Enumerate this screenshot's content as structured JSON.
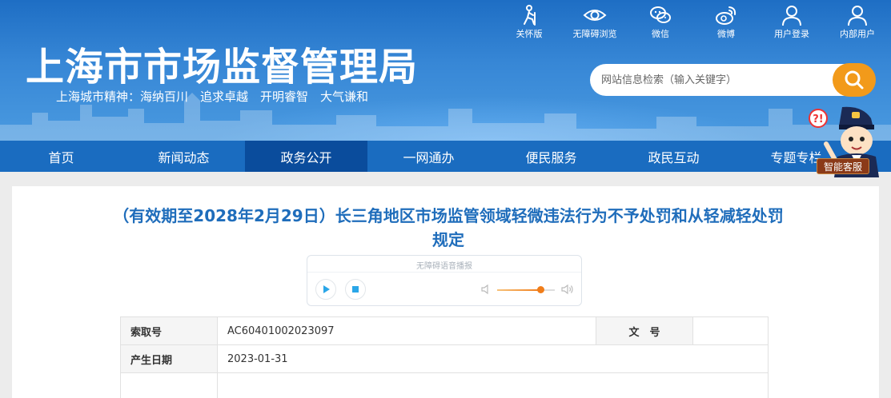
{
  "header": {
    "site_title": "上海市市场监督管理局",
    "slogan": "上海城市精神：海纳百川　追求卓越　开明睿智　大气谦和",
    "top_links": [
      {
        "label": "关怀版",
        "icon": "elderly-care-icon"
      },
      {
        "label": "无障碍浏览",
        "icon": "eye-icon"
      },
      {
        "label": "微信",
        "icon": "wechat-icon"
      },
      {
        "label": "微博",
        "icon": "weibo-icon"
      },
      {
        "label": "用户登录",
        "icon": "user-icon"
      },
      {
        "label": "内部用户",
        "icon": "user-icon"
      }
    ],
    "search": {
      "placeholder": "网站信息检索（输入关键字）",
      "icon": "search-icon"
    },
    "colors": {
      "header_blue": "#2a7bcf",
      "nav_blue": "#1a6cc0",
      "nav_active": "#0a4c9c",
      "search_orange": "#f29a1a",
      "title_blue": "#1f6dbb"
    }
  },
  "nav": {
    "items": [
      "首页",
      "新闻动态",
      "政务公开",
      "一网通办",
      "便民服务",
      "政民互动",
      "专题专栏"
    ],
    "active_index": 2
  },
  "service_bot": {
    "label": "智能客服",
    "icon": "customer-service-robot-icon"
  },
  "document": {
    "title": "（有效期至2028年2月29日）长三角地区市场监管领域轻微违法行为不予处罚和从轻减轻处罚规定",
    "player": {
      "title": "无障碍语音播报",
      "volume_level": 0.75,
      "play_icon": "play-icon",
      "stop_icon": "stop-icon"
    },
    "meta": {
      "row1": {
        "k1": "索取号",
        "v1": "AC60401002023097",
        "k2": "文　号",
        "v2": ""
      },
      "row2": {
        "k1": "产生日期",
        "v1": "2023-01-31"
      }
    }
  }
}
